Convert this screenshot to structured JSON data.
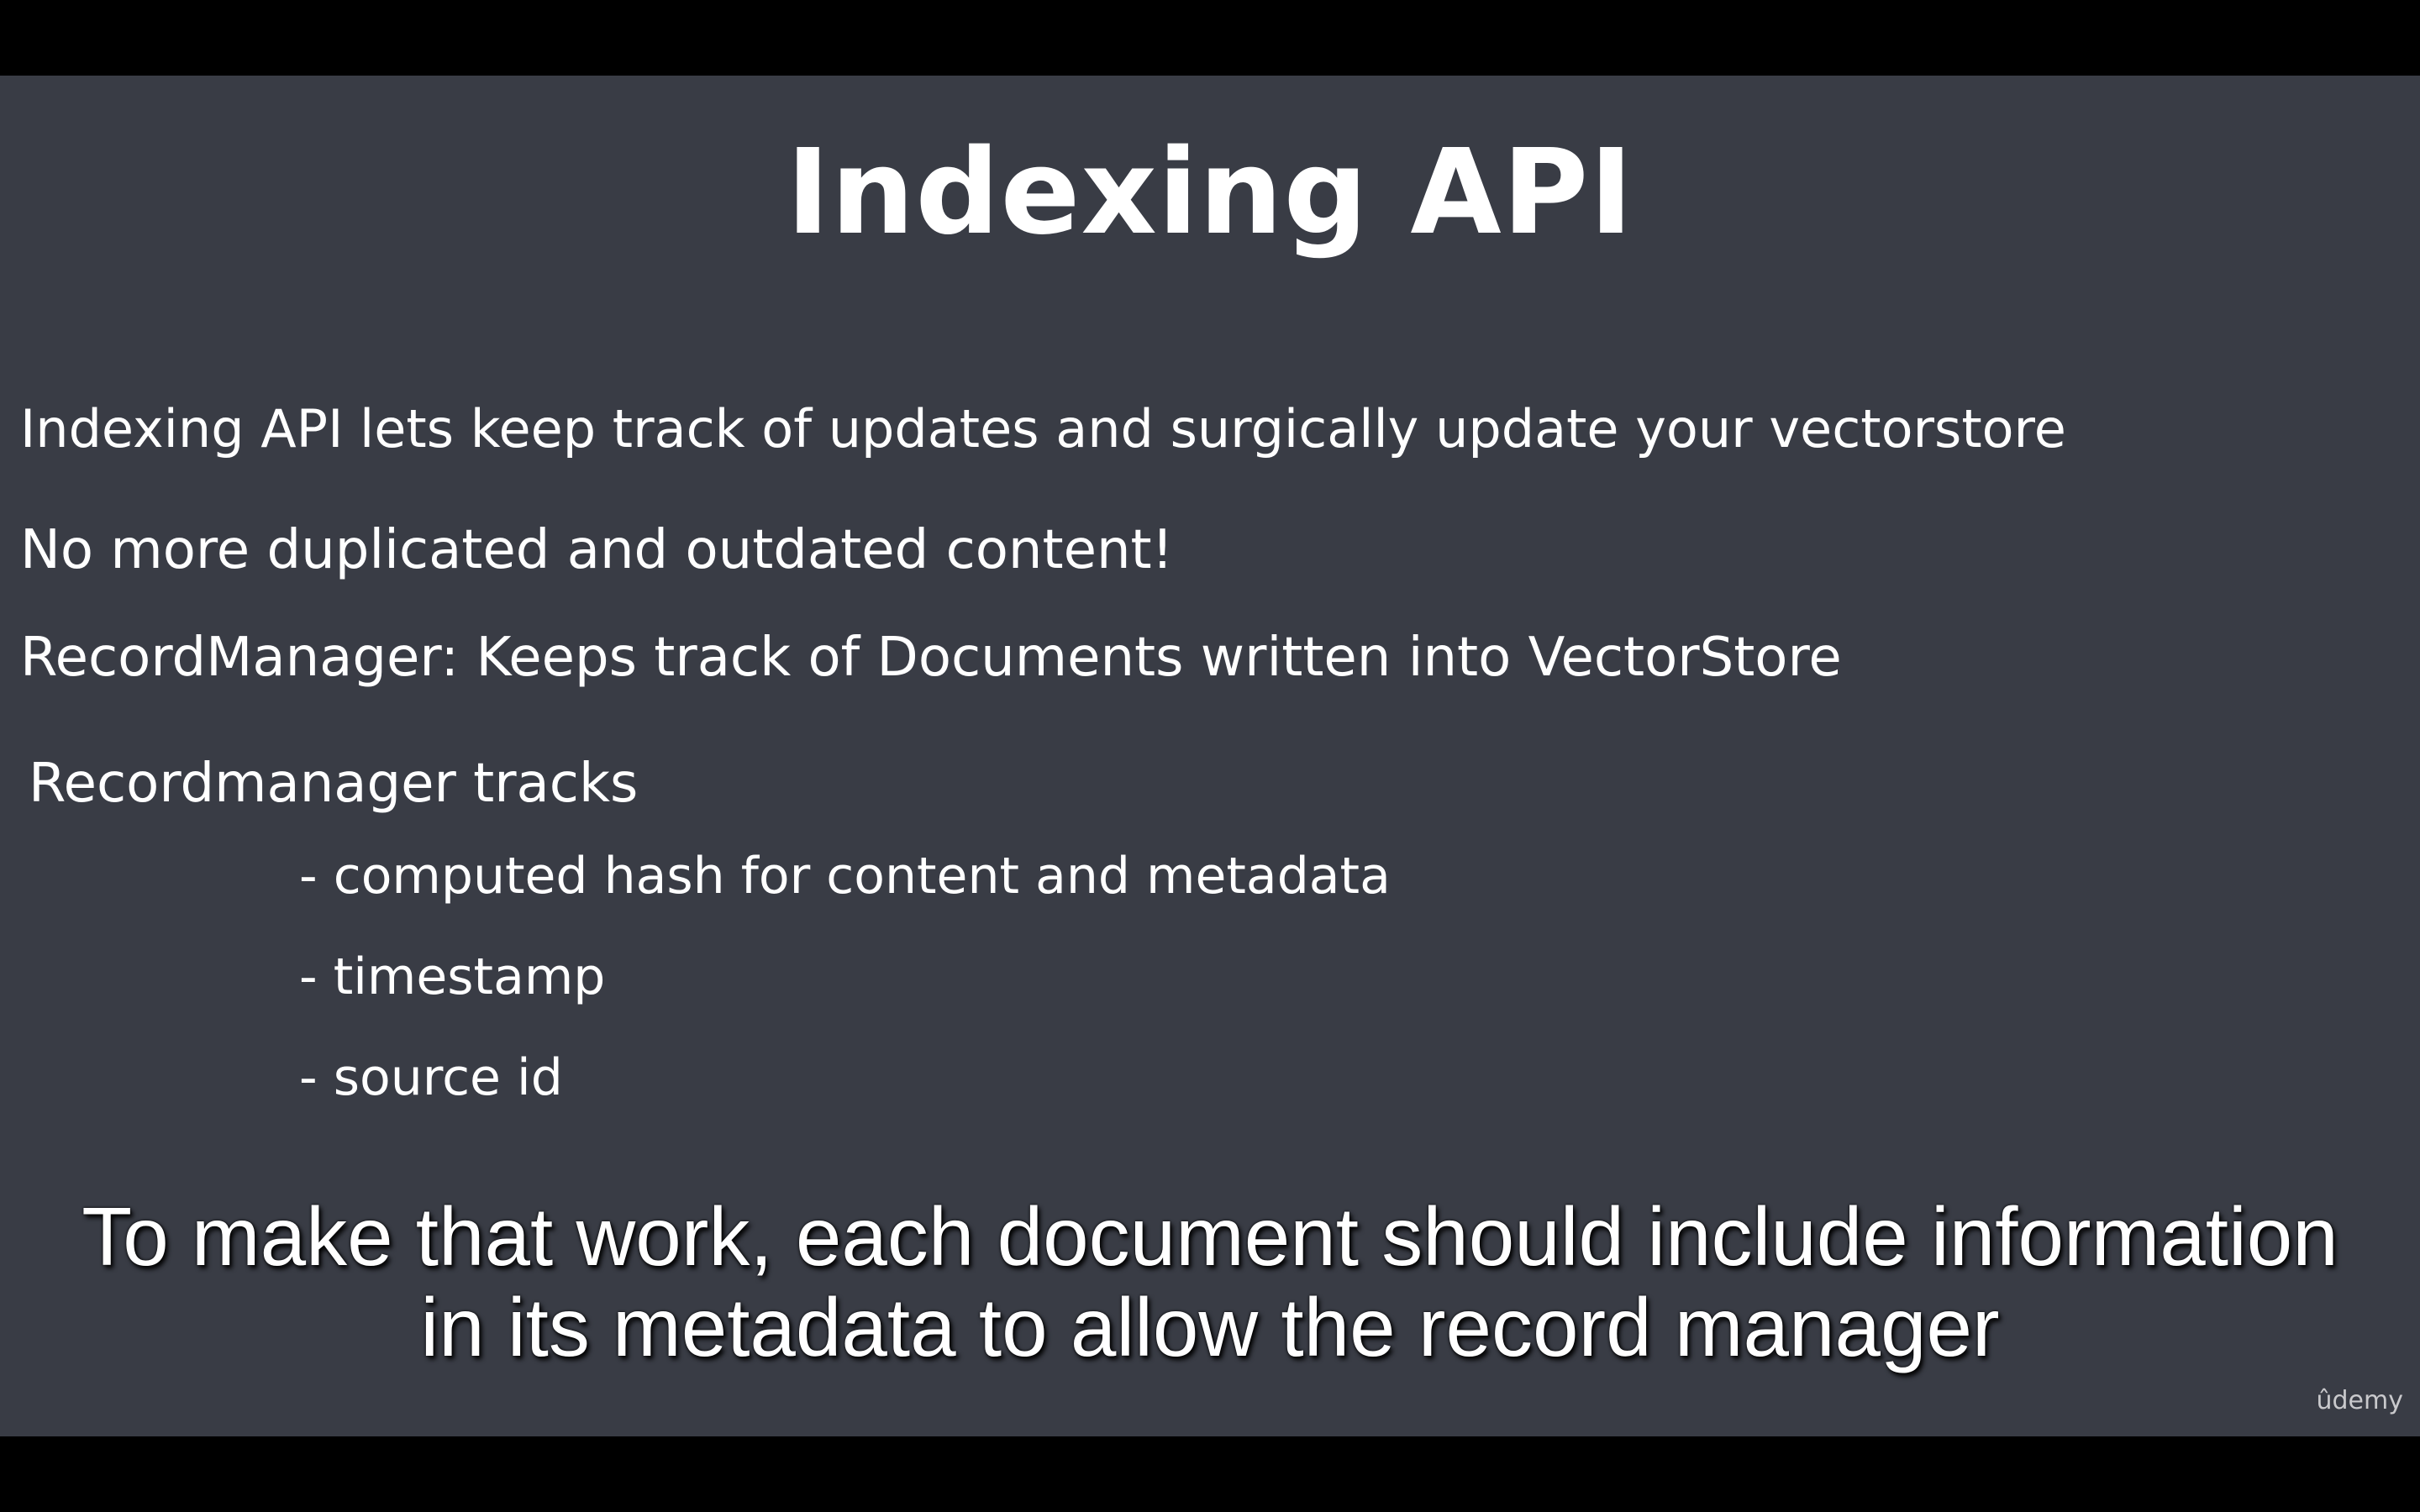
{
  "slide": {
    "title": "Indexing API",
    "lines": [
      "Indexing API lets keep track of updates and surgically update your vectorstore",
      "No more duplicated and outdated content!",
      "RecordManager: Keeps track of Documents written into VectorStore",
      "Recordmanager tracks"
    ],
    "bullets": [
      "- computed hash for content and metadata",
      "- timestamp",
      "- source id"
    ]
  },
  "caption": {
    "line1": "To make that work, each document should include information",
    "line2": "in its metadata to allow the record manager"
  },
  "watermark": "ûdemy",
  "colors": {
    "slide_background": "#393c45",
    "letterbox": "#000000",
    "text": "#ffffff"
  }
}
